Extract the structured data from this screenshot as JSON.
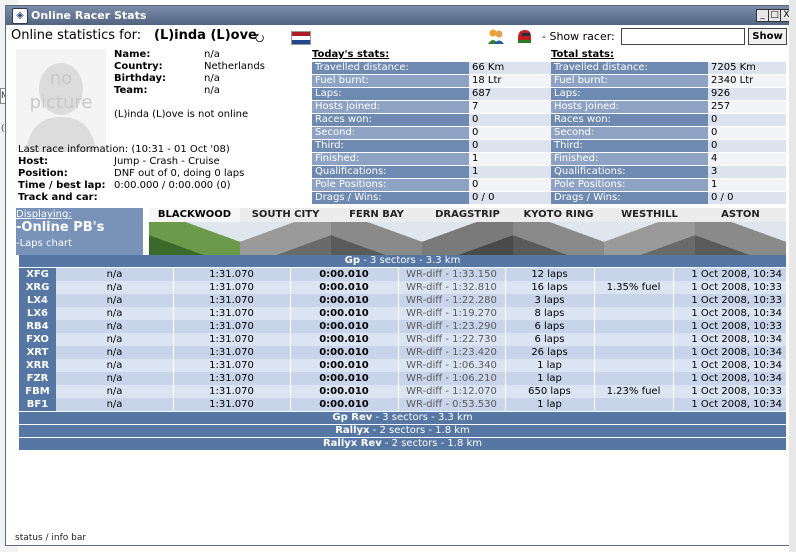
{
  "window": {
    "title": "Online Racer Stats",
    "buttons": [
      "_",
      "□",
      "X"
    ]
  },
  "header": {
    "label": "Online statistics for:",
    "racer": "(L)inda (L)ove",
    "swirl": "⭮",
    "show_racer_label": "- Show racer:",
    "show_racer_value": "",
    "show_button": "Show"
  },
  "profile": {
    "no_picture": "no picture",
    "name_label": "Name:",
    "name": "n/a",
    "country_label": "Country:",
    "country": "Netherlands",
    "birthday_label": "Birthday:",
    "birthday": "n/a",
    "team_label": "Team:",
    "team": "n/a",
    "online_status": "(L)inda (L)ove is not online",
    "last_race": "Last race information: (10:31 - 01 Oct '08)",
    "host_label": "Host:",
    "host": "Jump - Crash - Cruise",
    "position_label": "Position:",
    "position": "DNF out of 0, doing 0 laps",
    "time_label": "Time / best lap:",
    "time": "0:00.000 / 0:00.000 (0)",
    "track_label": "Track and car:"
  },
  "today": {
    "heading": "Today's stats:",
    "rows": [
      {
        "label": "Travelled distance:",
        "value": "66 Km"
      },
      {
        "label": "Fuel burnt:",
        "value": "18 Ltr"
      },
      {
        "label": "Laps:",
        "value": "687"
      },
      {
        "label": "Hosts joined:",
        "value": "7"
      },
      {
        "label": "Races won:",
        "value": "0"
      },
      {
        "label": "Second:",
        "value": "0"
      },
      {
        "label": "Third:",
        "value": "0"
      },
      {
        "label": "Finished:",
        "value": "1"
      },
      {
        "label": "Qualifications:",
        "value": "1"
      },
      {
        "label": "Pole Positions:",
        "value": "0"
      },
      {
        "label": "Drags / Wins:",
        "value": "0 / 0"
      }
    ]
  },
  "total": {
    "heading": "Total stats:",
    "rows": [
      {
        "label": "Travelled distance:",
        "value": "7205 Km"
      },
      {
        "label": "Fuel burnt:",
        "value": "2340 Ltr"
      },
      {
        "label": "Laps:",
        "value": "926"
      },
      {
        "label": "Hosts joined:",
        "value": "257"
      },
      {
        "label": "Races won:",
        "value": "0"
      },
      {
        "label": "Second:",
        "value": "0"
      },
      {
        "label": "Third:",
        "value": "0"
      },
      {
        "label": "Finished:",
        "value": "4"
      },
      {
        "label": "Qualifications:",
        "value": "3"
      },
      {
        "label": "Pole Positions:",
        "value": "1"
      },
      {
        "label": "Drags / Wins:",
        "value": "0 / 0"
      }
    ]
  },
  "pb_panel": {
    "displaying": "Displaying:",
    "title": "-Online PB's",
    "laps_chart": "-Laps chart"
  },
  "tracks": [
    "BLACKWOOD",
    "SOUTH CITY",
    "FERN BAY",
    "DRAGSTRIP",
    "KYOTO RING",
    "WESTHILL",
    "ASTON"
  ],
  "sections": [
    {
      "name": "Gp",
      "desc": " - 3 sectors - 3.3 km"
    },
    {
      "name": "Gp Rev",
      "desc": " - 3 sectors - 3.3 km"
    },
    {
      "name": "Rallyx",
      "desc": " - 2 sectors - 1.8 km"
    },
    {
      "name": "Rallyx Rev",
      "desc": " - 2 sectors - 1.8 km"
    }
  ],
  "pb_rows": [
    {
      "car": "XFG",
      "name": "n/a",
      "time": "1:31.070",
      "best": "0:00.010",
      "wr": "WR-diff - 1:33.150",
      "laps": "12 laps",
      "fuel": "",
      "date": "1 Oct 2008, 10:34"
    },
    {
      "car": "XRG",
      "name": "n/a",
      "time": "1:31.070",
      "best": "0:00.010",
      "wr": "WR-diff - 1:32.810",
      "laps": "16 laps",
      "fuel": "1.35% fuel",
      "date": "1 Oct 2008, 10:33"
    },
    {
      "car": "LX4",
      "name": "n/a",
      "time": "1:31.070",
      "best": "0:00.010",
      "wr": "WR-diff - 1:22.280",
      "laps": "3 laps",
      "fuel": "",
      "date": "1 Oct 2008, 10:33"
    },
    {
      "car": "LX6",
      "name": "n/a",
      "time": "1:31.070",
      "best": "0:00.010",
      "wr": "WR-diff - 1:19.270",
      "laps": "8 laps",
      "fuel": "",
      "date": "1 Oct 2008, 10:34"
    },
    {
      "car": "RB4",
      "name": "n/a",
      "time": "1:31.070",
      "best": "0:00.010",
      "wr": "WR-diff - 1:23.290",
      "laps": "6 laps",
      "fuel": "",
      "date": "1 Oct 2008, 10:33"
    },
    {
      "car": "FXO",
      "name": "n/a",
      "time": "1:31.070",
      "best": "0:00.010",
      "wr": "WR-diff - 1:22.730",
      "laps": "6 laps",
      "fuel": "",
      "date": "1 Oct 2008, 10:34"
    },
    {
      "car": "XRT",
      "name": "n/a",
      "time": "1:31.070",
      "best": "0:00.010",
      "wr": "WR-diff - 1:23.420",
      "laps": "26 laps",
      "fuel": "",
      "date": "1 Oct 2008, 10:34"
    },
    {
      "car": "XRR",
      "name": "n/a",
      "time": "1:31.070",
      "best": "0:00.010",
      "wr": "WR-diff - 1:06.340",
      "laps": "1 lap",
      "fuel": "",
      "date": "1 Oct 2008, 10:34"
    },
    {
      "car": "FZR",
      "name": "n/a",
      "time": "1:31.070",
      "best": "0:00.010",
      "wr": "WR-diff - 1:06.210",
      "laps": "1 lap",
      "fuel": "",
      "date": "1 Oct 2008, 10:34"
    },
    {
      "car": "FBM",
      "name": "n/a",
      "time": "1:31.070",
      "best": "0:00.010",
      "wr": "WR-diff - 1:12.070",
      "laps": "650 laps",
      "fuel": "1.23% fuel",
      "date": "1 Oct 2008, 10:33"
    },
    {
      "car": "BF1",
      "name": "n/a",
      "time": "1:31.070",
      "best": "0:00.010",
      "wr": "WR-diff - 0:53.530",
      "laps": "1 lap",
      "fuel": "",
      "date": "1 Oct 2008, 10:34"
    }
  ],
  "status_bar": "status / info bar",
  "background": {
    "fragment_a": "Mo",
    "fragment_b": "(L"
  }
}
